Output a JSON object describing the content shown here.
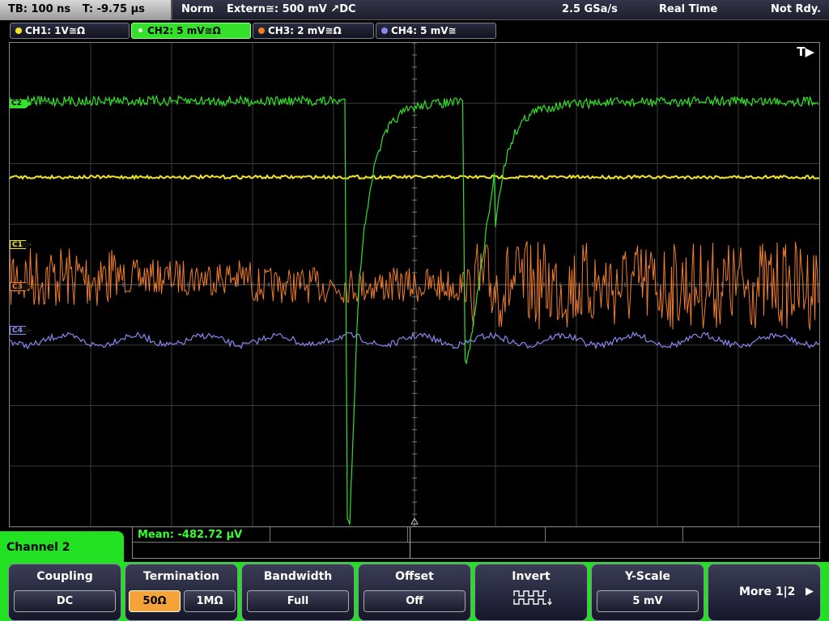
{
  "topbar": {
    "timebase": "TB: 100 ns",
    "trigger_time": "T: -9.75 µs",
    "trigger_mode": "Norm",
    "trigger_source": "Extern≅: 500 mV ↗DC",
    "sample_rate": "2.5 GSa/s",
    "acq_mode": "Real Time",
    "status": "Not Rdy."
  },
  "channels": [
    {
      "label": "CH1: 1V≅Ω",
      "color": "#f0e623",
      "active": false
    },
    {
      "label": "CH2: 5 mV≅Ω",
      "color": "#33e02a",
      "active": true
    },
    {
      "label": "CH3: 2 mV≅Ω",
      "color": "#f07d2a",
      "active": false
    },
    {
      "label": "CH4: 5 mV≅",
      "color": "#8a87f0",
      "active": false
    }
  ],
  "markers": {
    "trigger_indicator": "T▶",
    "c1": "C1",
    "c2": "C2",
    "c3": "C3",
    "c4": "C4"
  },
  "measurement": {
    "mean": "Mean: -482.72 µV"
  },
  "menu": {
    "title": "Channel 2",
    "coupling": {
      "label": "Coupling",
      "value": "DC"
    },
    "termination": {
      "label": "Termination",
      "options": [
        "50Ω",
        "1MΩ"
      ],
      "selected": "50Ω"
    },
    "bandwidth": {
      "label": "Bandwidth",
      "value": "Full"
    },
    "offset": {
      "label": "Offset",
      "value": "Off"
    },
    "invert": {
      "label": "Invert"
    },
    "yscale": {
      "label": "Y-Scale",
      "value": "5 mV"
    },
    "more": {
      "label": "More 1|2",
      "arrow": "▶"
    }
  },
  "colors": {
    "ch1": "#f0e623",
    "ch2": "#33e02a",
    "ch3": "#f07d2a",
    "ch4": "#8a87f0",
    "menu_accent": "#22e022",
    "selected_option": "#f3a33a"
  }
}
